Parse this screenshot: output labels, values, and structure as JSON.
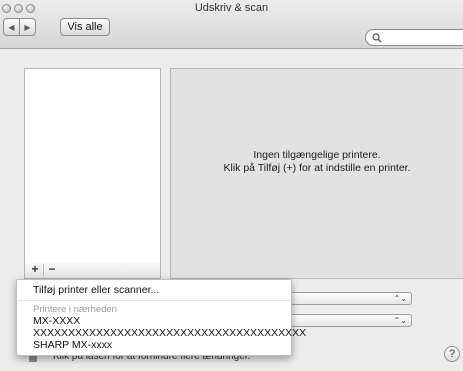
{
  "window": {
    "title": "Udskriv & scan"
  },
  "toolbar": {
    "back_label": "◀",
    "forward_label": "▶",
    "show_all_label": "Vis alle",
    "search_placeholder": ""
  },
  "main": {
    "add_label": "+",
    "remove_label": "−",
    "empty_line1": "Ingen tilgængelige printere.",
    "empty_line2": "Klik på Tilføj (+) for at indstille en printer."
  },
  "menu": {
    "add_item": "Tilføj printer eller scanner...",
    "section_header": "Printere i nærheden",
    "printers": [
      "MX-XXXX",
      "XXXXXXXXXXXXXXXXXXXXXXXXXXXXXXXXXXXXXXX",
      "SHARP MX-xxxx"
    ]
  },
  "footer": {
    "lock_text": "Klik på låsen for at forhindre flere ændringer.",
    "help_label": "?"
  },
  "popups": {
    "arrows_glyph": "⌃⌄"
  },
  "icons": {
    "close": "close-icon",
    "minimize": "minimize-icon",
    "zoom": "zoom-icon",
    "search": "search-icon",
    "lock": "lock-icon"
  }
}
